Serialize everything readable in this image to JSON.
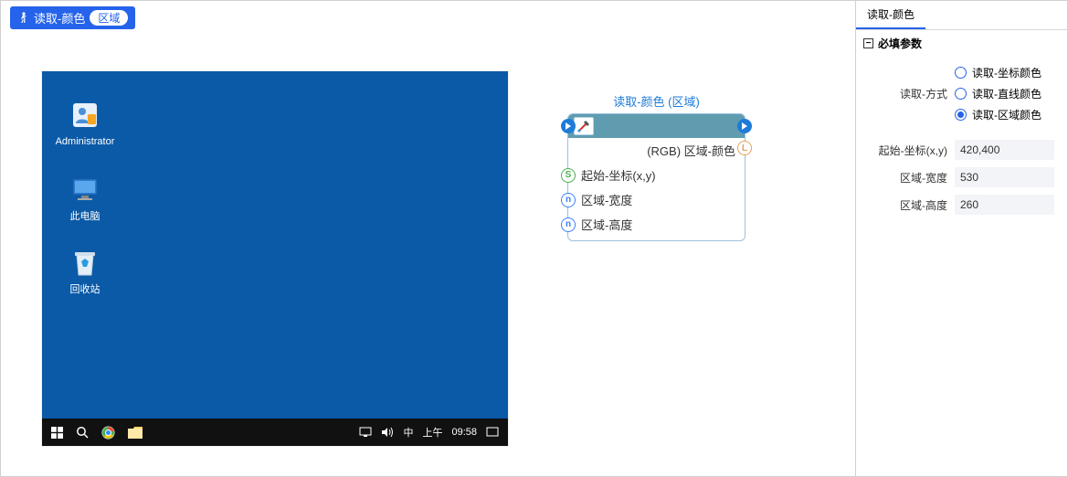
{
  "header": {
    "pill_icon": "person-walk-icon",
    "pill_label": "读取-颜色",
    "pill_badge": "区域"
  },
  "desktop": {
    "icons": [
      {
        "name": "admin",
        "label": "Administrator"
      },
      {
        "name": "this-pc",
        "label": "此电脑"
      },
      {
        "name": "recycle",
        "label": "回收站"
      }
    ],
    "taskbar": {
      "ime": "中",
      "time_prefix": "上午",
      "time": "09:58"
    }
  },
  "node": {
    "title": "读取-颜色 (区域)",
    "out_label": "(RGB) 区域-颜色",
    "rows": [
      {
        "port": "S",
        "label": "起始-坐标(x,y)"
      },
      {
        "port": "n",
        "label": "区域-宽度"
      },
      {
        "port": "n",
        "label": "区域-高度"
      }
    ]
  },
  "sidebar": {
    "tab": "读取-颜色",
    "section_title": "必填参数",
    "mode_label": "读取-方式",
    "mode_options": [
      {
        "label": "读取-坐标颜色",
        "checked": false
      },
      {
        "label": "读取-直线颜色",
        "checked": false
      },
      {
        "label": "读取-区域颜色",
        "checked": true
      }
    ],
    "fields": [
      {
        "label": "起始-坐标(x,y)",
        "value": "420,400"
      },
      {
        "label": "区域-宽度",
        "value": "530"
      },
      {
        "label": "区域-高度",
        "value": "260"
      }
    ]
  }
}
